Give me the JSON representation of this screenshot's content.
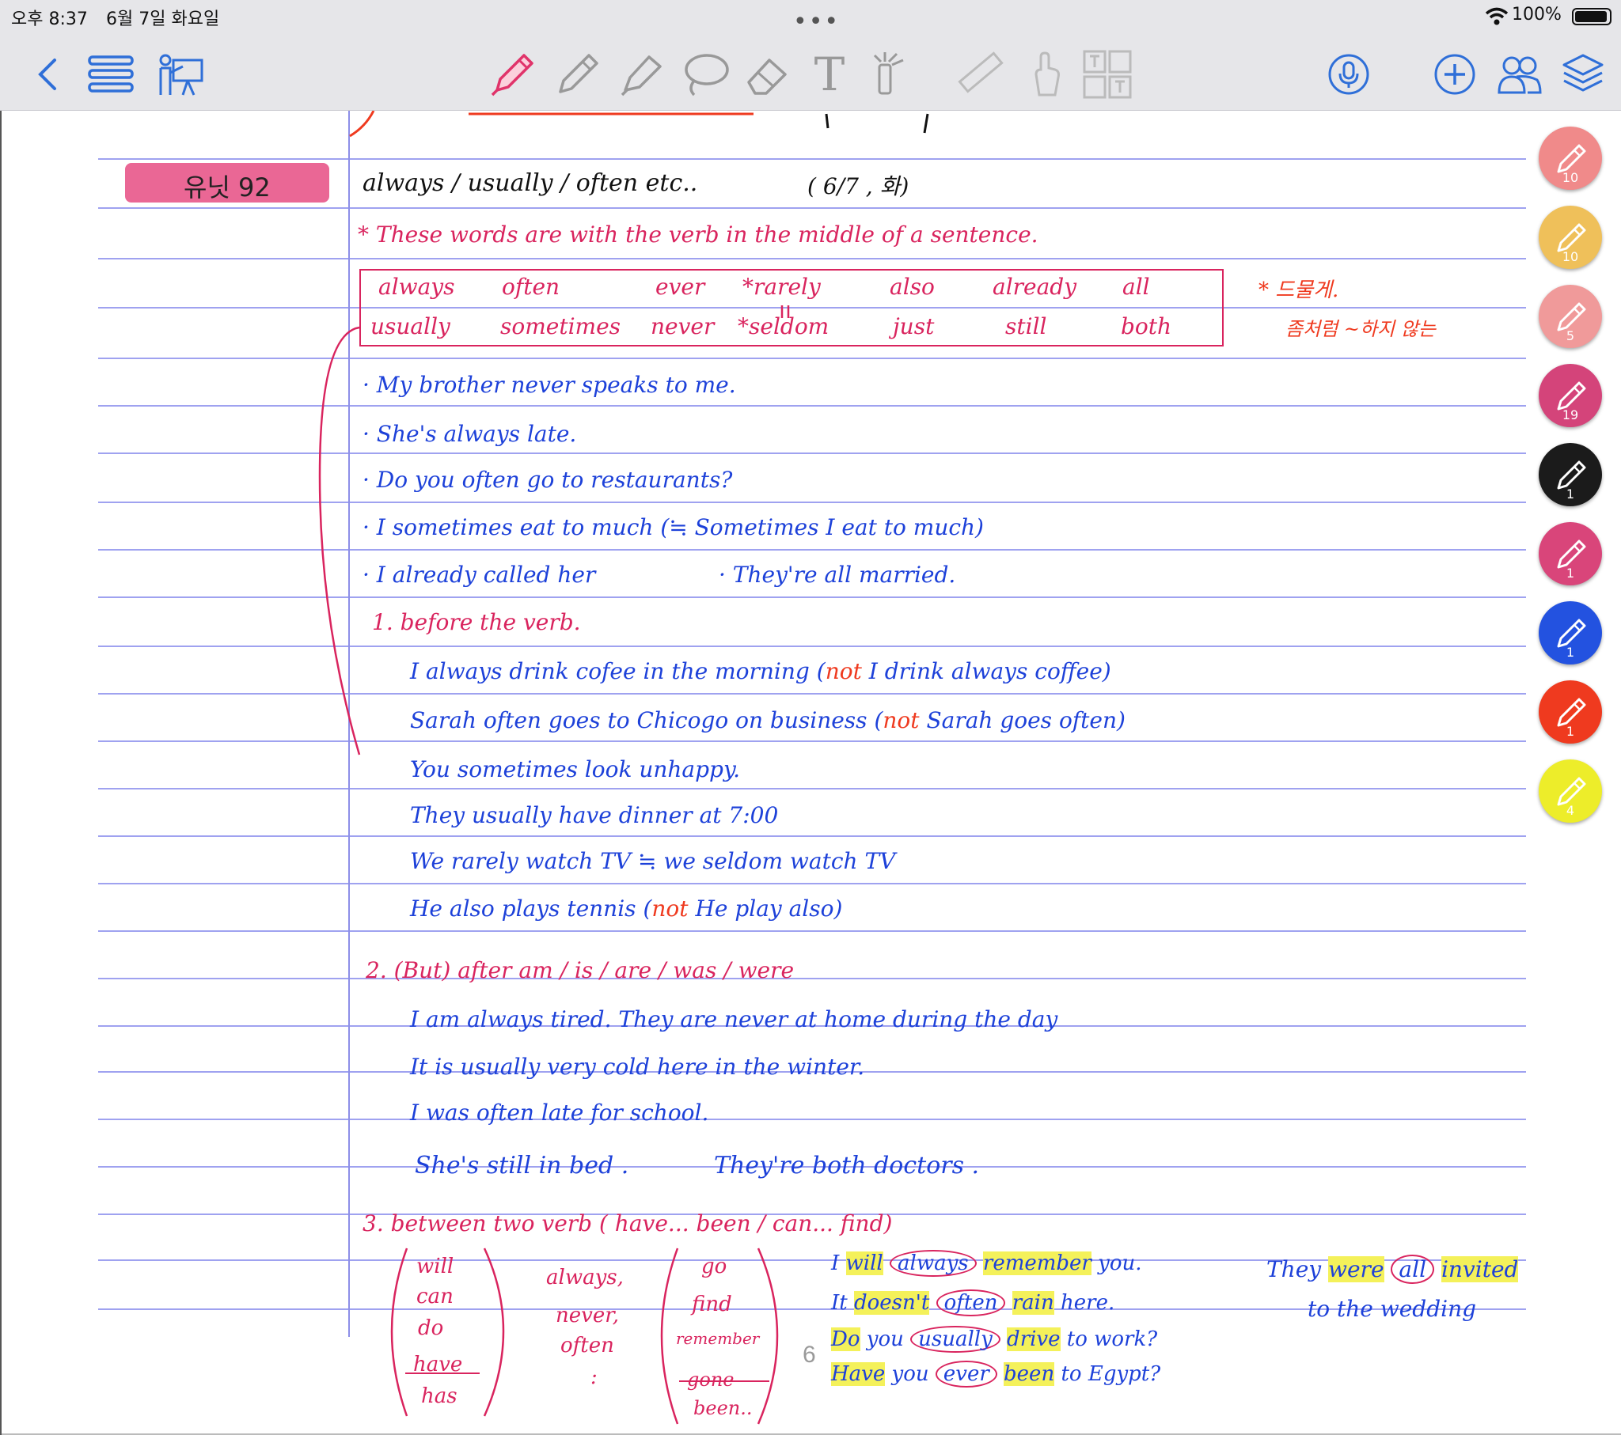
{
  "status_bar": {
    "time": "오후 8:37",
    "date": "6월 7일 화요일",
    "more": "•••",
    "battery": "100%"
  },
  "toolbar": {
    "icons": [
      "back-icon",
      "menu-icon",
      "presentation-icon",
      "pen-icon",
      "pencil-icon",
      "highlighter-icon",
      "lasso-icon",
      "eraser-icon",
      "text-icon",
      "laser-pointer-icon",
      "ruler-icon",
      "hand-icon",
      "image-text-icon",
      "microphone-icon",
      "add-icon",
      "collaborate-icon",
      "layers-icon"
    ],
    "text_tool_glyph": "T"
  },
  "colors": {
    "blue_ink": "#1d41d9",
    "pink_ink": "#d9245e",
    "red_ink": "#ef3a1f",
    "highlight_yellow": "#f4f15a",
    "ruled_line": "#9fa2f0"
  },
  "note": {
    "unit_label": "유닛 92",
    "title": "always / usually / often etc..",
    "title_date": "( 6/7 , 화)",
    "intro": "* These words are with the verb in the middle of a sentence.",
    "words_row1": [
      "always",
      "often",
      "ever",
      "*rarely",
      "also",
      "already",
      "all"
    ],
    "words_row2": [
      "usually",
      "sometimes",
      "never",
      "*seldom",
      "just",
      "still",
      "both"
    ],
    "side_note1": "* 드물게.",
    "side_note2": "좀처럼 ~하지 않는",
    "examples": [
      "· My brother never speaks to me.",
      "· She's always late.",
      "· Do you often go to restaurants?",
      "· I sometimes eat to much (≒ Sometimes I eat to much)",
      "· I already called her",
      "· They're all married."
    ],
    "section1_heading": "1. before the verb.",
    "section1": [
      {
        "text": "I always drink cofee in the morning",
        "note_not": "not",
        "note_rest": "I drink always coffee)"
      },
      {
        "text": "Sarah often goes to Chicogo on business",
        "note_not": "not",
        "note_rest": "Sarah goes often)"
      },
      {
        "text": "You sometimes look unhappy."
      },
      {
        "text": "They usually have dinner at 7:00"
      },
      {
        "text": "We rarely watch TV ≒ we seldom watch TV"
      },
      {
        "text": "He also plays tennis",
        "note_not": "not",
        "note_rest": "He play also)"
      }
    ],
    "section2_heading": "2. (But) after am / is / are / was / were",
    "section2": [
      "I am always tired. They are never at home during the day",
      "It is usually very cold here in the winter.",
      "I was often late for school.",
      "She's still in bed .",
      "They're both doctors ."
    ],
    "section3_heading": "3. between two verb ( have... been / can... find)",
    "aux_list": [
      "will",
      "can",
      "do",
      "have",
      "has"
    ],
    "adverb_list": [
      "always,",
      "never,",
      "often",
      ":"
    ],
    "verb_list": [
      "go",
      "find",
      "remember",
      "gone",
      "been.."
    ],
    "section3_examples": [
      {
        "pre": "I",
        "hl1": "will",
        "circ": "always",
        "hl2": "remember",
        "post": "you."
      },
      {
        "pre": "It",
        "hl1": "doesn't",
        "circ": "often",
        "hl2": "rain",
        "post": "here."
      },
      {
        "pre": "",
        "hl1": "Do",
        "mid": "you",
        "circ": "usually",
        "hl2": "drive",
        "post": "to work?"
      },
      {
        "pre": "",
        "hl1": "Have",
        "mid": "you",
        "circ": "ever",
        "hl2": "been",
        "post": "to Egypt?"
      }
    ],
    "side_example": {
      "they": "They",
      "were": "were",
      "all": "all",
      "invited": "invited",
      "line2": "to the wedding"
    },
    "page_number": "6"
  },
  "pens": [
    {
      "color": "#f08a8a",
      "count": "10"
    },
    {
      "color": "#efc05a",
      "count": "10"
    },
    {
      "color": "#f09a9a",
      "count": "5"
    },
    {
      "color": "#d4447a",
      "count": "19"
    },
    {
      "color": "#1b1b1b",
      "count": "1"
    },
    {
      "color": "#d9457a",
      "count": "1"
    },
    {
      "color": "#2352e0",
      "count": "1"
    },
    {
      "color": "#ef3a1f",
      "count": "1"
    },
    {
      "color": "#eded2a",
      "count": "4"
    }
  ]
}
